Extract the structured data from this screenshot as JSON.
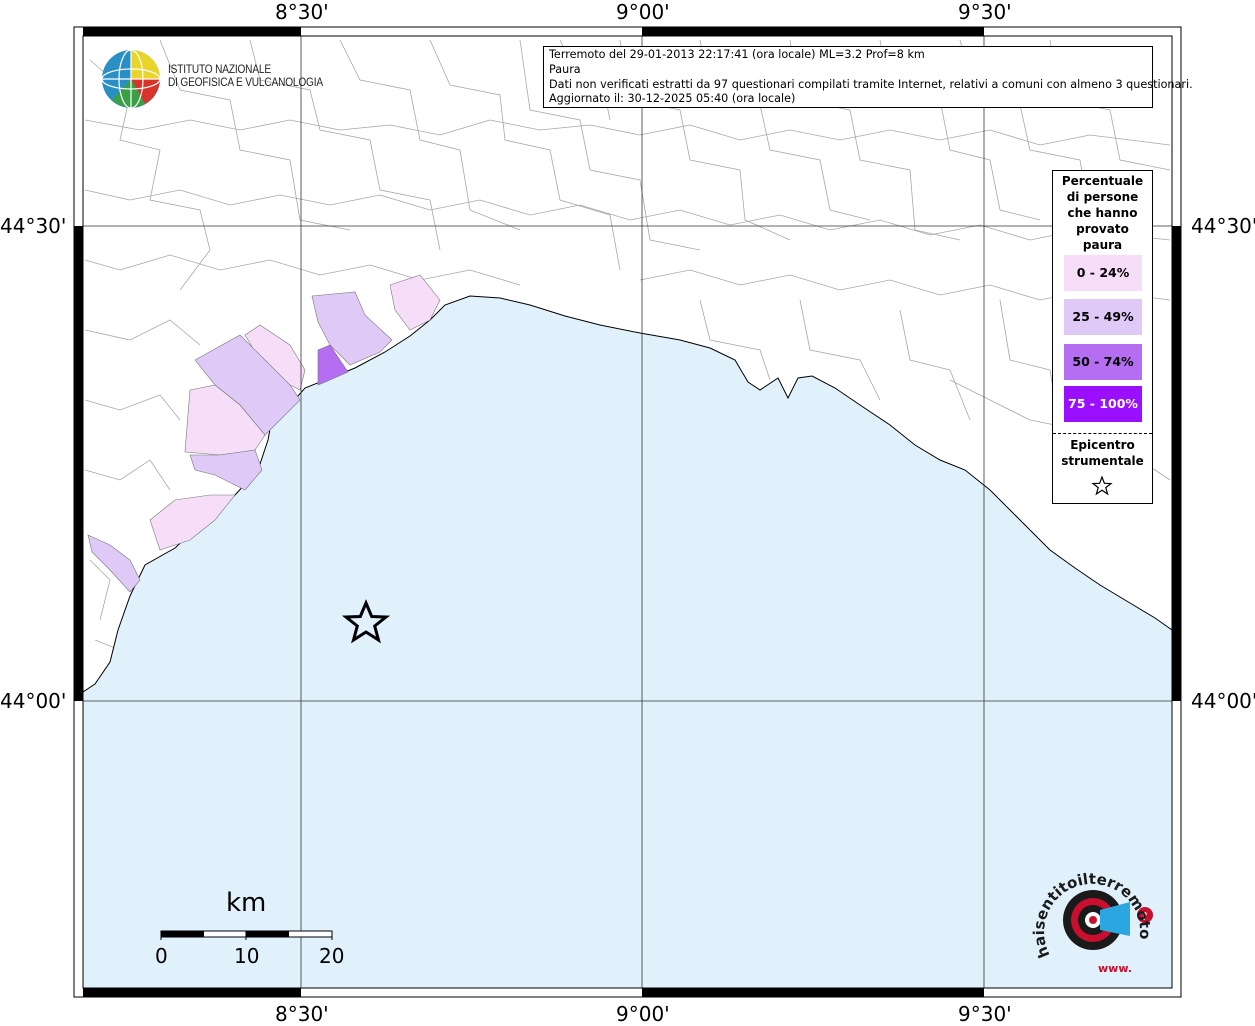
{
  "map": {
    "longitude_labels": [
      "8°30'",
      "9°00'",
      "9°30'"
    ],
    "latitude_labels": [
      "44°30'",
      "44°00'"
    ],
    "colors": {
      "sea": "#e0f1fc",
      "land": "#ffffff",
      "border": "#999999",
      "class_0_24": "#f6ddf8",
      "class_25_49": "#dfc9f7",
      "class_50_74": "#b56df2",
      "class_75_100": "#9a0fff"
    },
    "epicenter_marker": "star-icon"
  },
  "logo": {
    "name_line1": "ISTITUTO NAZIONALE",
    "name_line2": "DI GEOFISICA E VULCANOLOGIA"
  },
  "info": {
    "line1": "Terremoto del 29-01-2013 22:17:41 (ora locale) ML=3.2 Prof=8 km",
    "line2": "Paura",
    "line3": "Dati non verificati estratti da 97 questionari compilati tramite Internet, relativi a comuni con almeno 3 questionari.",
    "line4": "Aggiornato il: 30-12-2025 05:40 (ora locale)"
  },
  "legend": {
    "title": "Percentuale di persone che hanno provato paura",
    "items": [
      {
        "label": "0 - 24%",
        "color": "#f6ddf8",
        "text_color": "#000000"
      },
      {
        "label": "25 - 49%",
        "color": "#dfc9f7",
        "text_color": "#000000"
      },
      {
        "label": "50 - 74%",
        "color": "#b56df2",
        "text_color": "#000000"
      },
      {
        "label": "75 - 100%",
        "color": "#9a0fff",
        "text_color": "#ffffff"
      }
    ],
    "epicenter_label": "Epicentro strumentale"
  },
  "scale": {
    "unit": "km",
    "ticks": [
      "0",
      "10",
      "20"
    ]
  },
  "badge": {
    "text": "haisentitoilterremoto.it",
    "sub": "www."
  }
}
